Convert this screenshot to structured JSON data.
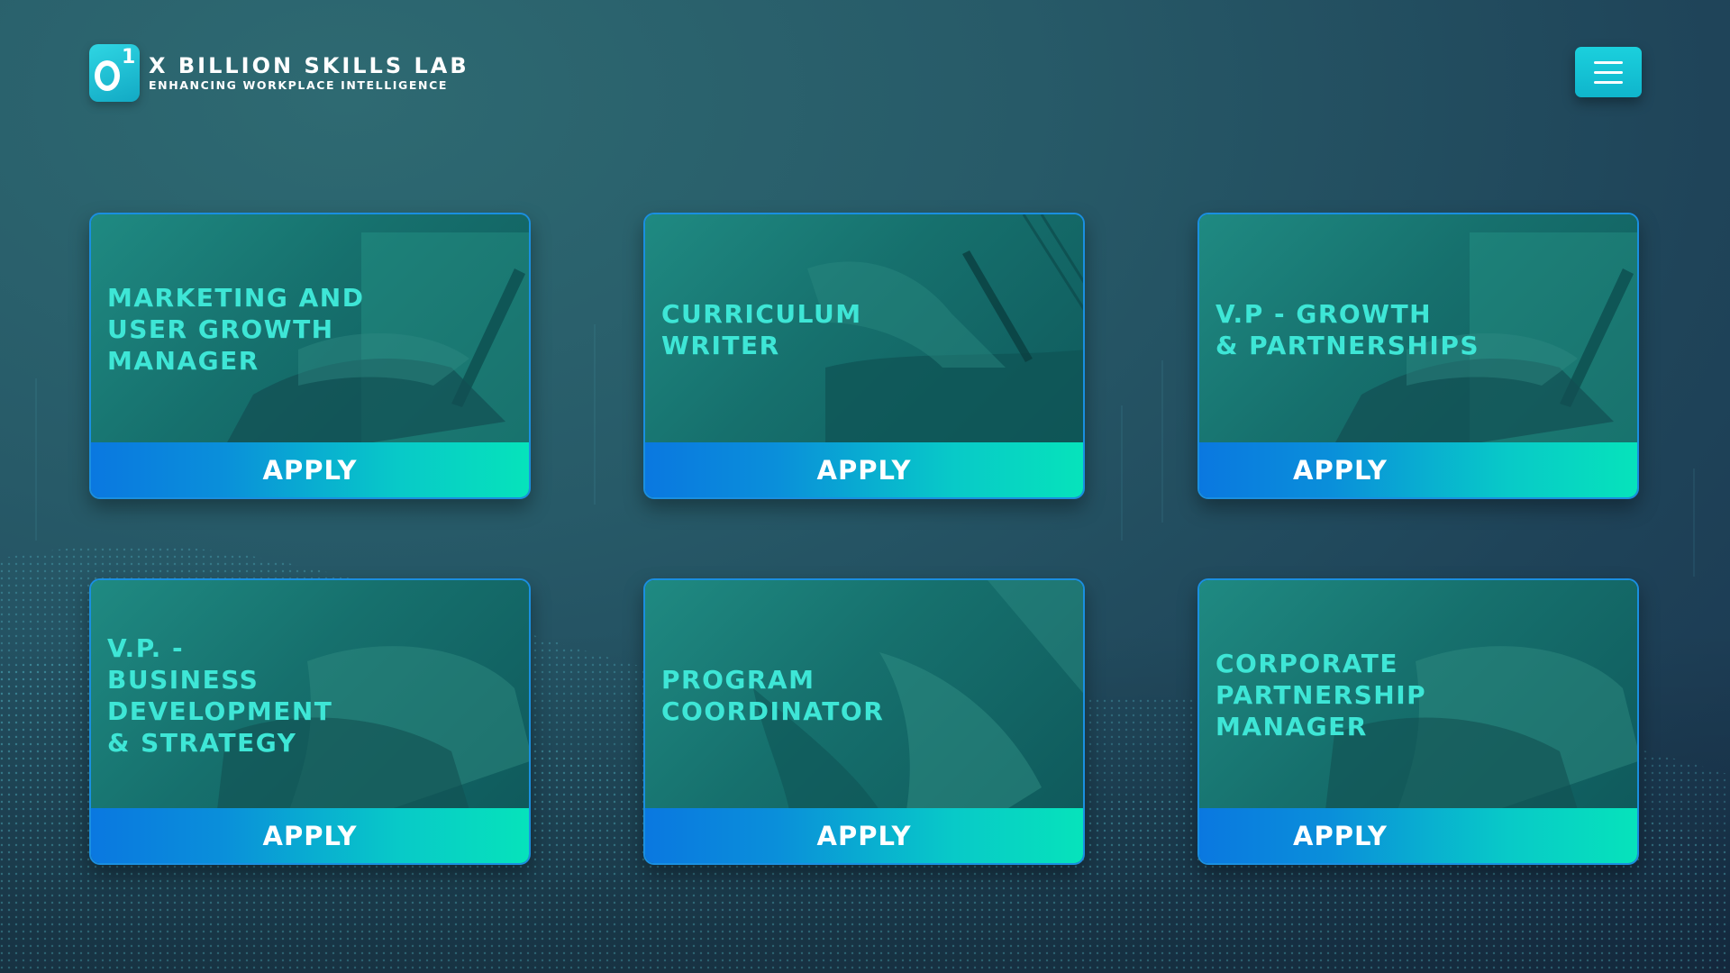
{
  "brand": {
    "title": "X BILLION SKILLS LAB",
    "tagline": "ENHANCING WORKPLACE INTELLIGENCE",
    "logo_icon": "x-billion-logo-icon",
    "logo_glyph": "1"
  },
  "header": {
    "menu_icon": "hamburger-menu-icon"
  },
  "colors": {
    "accent": "#1bd0dd",
    "title_text": "#3ee6d6",
    "apply_gradient_start": "#0a78e0",
    "apply_gradient_end": "#06e3bb",
    "card_border": "#1a8fe0"
  },
  "jobs": [
    {
      "title": "MARKETING AND\nUSER GROWTH\nMANAGER",
      "apply_label": "APPLY"
    },
    {
      "title": "CURRICULUM\nWRITER",
      "apply_label": "APPLY"
    },
    {
      "title": "V.P - GROWTH\n& PARTNERSHIPS",
      "apply_label": "APPLY"
    },
    {
      "title": "V.P. -\nBUSINESS\nDEVELOPMENT\n& STRATEGY",
      "apply_label": "APPLY"
    },
    {
      "title": "PROGRAM\nCOORDINATOR",
      "apply_label": "APPLY"
    },
    {
      "title": "CORPORATE\nPARTNERSHIP\nMANAGER",
      "apply_label": "APPLY"
    }
  ]
}
